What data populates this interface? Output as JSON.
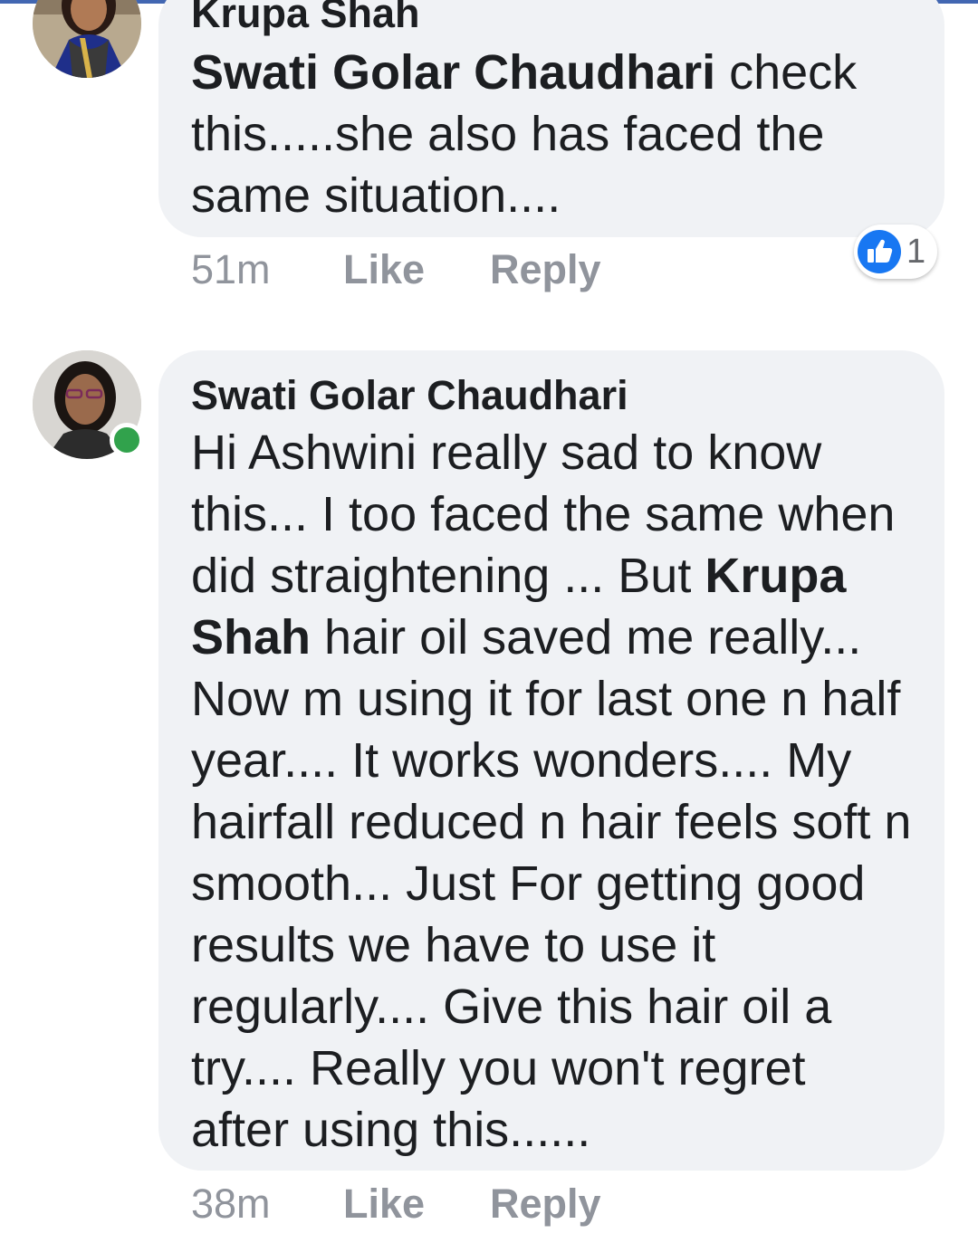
{
  "comments": [
    {
      "author": "Krupa Shah",
      "mention": "Swati Golar Chaudhari",
      "text_after_mention": " check this.....she also has faced the same situation....",
      "time": "51m",
      "like_label": "Like",
      "reply_label": "Reply",
      "reaction_icon": "thumbs-up-icon",
      "reaction_count": "1",
      "avatar_icon": "profile-photo"
    },
    {
      "author": "Swati Golar Chaudhari",
      "text_before_mention": "Hi Ashwini really sad to know this... I too faced the same when did straightening ... But ",
      "mention": "Krupa Shah",
      "text_after_mention": " hair oil saved me really... Now m using it for last one n half year.... It works wonders.... My hairfall reduced n hair feels soft n smooth... Just For getting good results we have to use it regularly.... Give this hair oil a try.... Really you won't regret after using this......",
      "time": "38m",
      "like_label": "Like",
      "reply_label": "Reply",
      "online_status": "online",
      "avatar_icon": "profile-photo"
    }
  ],
  "colors": {
    "bubble": "#f0f2f5",
    "text": "#1c1e21",
    "meta": "#90949c",
    "like_blue": "#1877f2",
    "online_green": "#31a24c",
    "top_bar": "#4267b2"
  }
}
